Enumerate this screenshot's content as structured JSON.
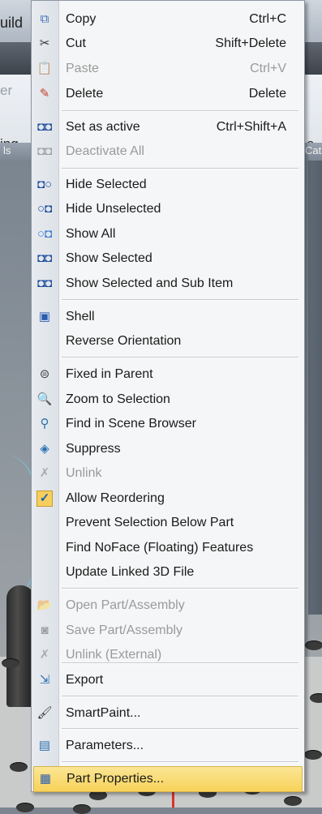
{
  "background": {
    "title_fragment": "uild",
    "ribbon_texts": [
      "er",
      "ing",
      "e"
    ],
    "ribbon_labels": [
      "ls",
      "Cata"
    ]
  },
  "menu": {
    "items": [
      {
        "label": "Copy",
        "shortcut": "Ctrl+C",
        "icon": "copy-icon",
        "glyph": "⧉",
        "color": "#3b6fb6",
        "disabled": false
      },
      {
        "label": "Cut",
        "shortcut": "Shift+Delete",
        "icon": "scissors-icon",
        "glyph": "✂",
        "color": "#333333",
        "disabled": false
      },
      {
        "label": "Paste",
        "shortcut": "Ctrl+V",
        "icon": "paste-icon",
        "glyph": "📋",
        "color": "#8a8a8a",
        "disabled": true
      },
      {
        "label": "Delete",
        "shortcut": "Delete",
        "icon": "eraser-icon",
        "glyph": "✎",
        "color": "#c2402a",
        "disabled": false
      },
      {
        "label": "Set as active",
        "shortcut": "Ctrl+Shift+A",
        "icon": "set-active-icon",
        "glyph": "◘◘",
        "color": "#1f4e9c",
        "disabled": false
      },
      {
        "label": "Deactivate All",
        "shortcut": "",
        "icon": "deactivate-all-icon",
        "glyph": "◘◘",
        "color": "#6a6a6a",
        "disabled": true
      },
      {
        "label": "Hide Selected",
        "shortcut": "",
        "icon": "hide-selected-icon",
        "glyph": "◘○",
        "color": "#1f4e9c",
        "disabled": false
      },
      {
        "label": "Hide Unselected",
        "shortcut": "",
        "icon": "hide-unselected-icon",
        "glyph": "○◘",
        "color": "#1f4e9c",
        "disabled": false
      },
      {
        "label": "Show All",
        "shortcut": "",
        "icon": "show-all-icon",
        "glyph": "○◘",
        "color": "#3f7fd0",
        "disabled": false
      },
      {
        "label": "Show Selected",
        "shortcut": "",
        "icon": "show-selected-icon",
        "glyph": "◘◘",
        "color": "#1f4e9c",
        "disabled": false
      },
      {
        "label": "Show Selected and Sub Item",
        "shortcut": "",
        "icon": "show-selected-sub-icon",
        "glyph": "◘◘",
        "color": "#1f4e9c",
        "disabled": false
      },
      {
        "label": "Shell",
        "shortcut": "",
        "icon": "shell-icon",
        "glyph": "▣",
        "color": "#2a5db0",
        "disabled": false
      },
      {
        "label": "Reverse Orientation",
        "shortcut": "",
        "icon": "",
        "glyph": "",
        "color": "#333333",
        "disabled": false
      },
      {
        "label": "Fixed in Parent",
        "shortcut": "",
        "icon": "fixed-in-parent-icon",
        "glyph": "⊜",
        "color": "#444444",
        "disabled": false
      },
      {
        "label": "Zoom to Selection",
        "shortcut": "",
        "icon": "zoom-icon",
        "glyph": "🔍",
        "color": "#444444",
        "disabled": false
      },
      {
        "label": "Find in Scene Browser",
        "shortcut": "",
        "icon": "find-scene-icon",
        "glyph": "⚲",
        "color": "#2a6fb0",
        "disabled": false
      },
      {
        "label": "Suppress",
        "shortcut": "",
        "icon": "suppress-icon",
        "glyph": "◈",
        "color": "#2a6fb0",
        "disabled": false
      },
      {
        "label": "Unlink",
        "shortcut": "",
        "icon": "unlink-icon",
        "glyph": "✗",
        "color": "#7a7a7a",
        "disabled": true
      },
      {
        "label": "Allow Reordering",
        "shortcut": "",
        "icon": "checkmark-icon",
        "glyph": "✓",
        "color": "#1f5fb5",
        "disabled": false,
        "checked": true
      },
      {
        "label": "Prevent Selection Below Part",
        "shortcut": "",
        "icon": "",
        "glyph": "",
        "color": "#333333",
        "disabled": false
      },
      {
        "label": "Find NoFace (Floating) Features",
        "shortcut": "",
        "icon": "",
        "glyph": "",
        "color": "#333333",
        "disabled": false
      },
      {
        "label": "Update Linked 3D File",
        "shortcut": "",
        "icon": "",
        "glyph": "",
        "color": "#333333",
        "disabled": false
      },
      {
        "label": "Open Part/Assembly",
        "shortcut": "",
        "icon": "open-folder-icon",
        "glyph": "📂",
        "color": "#666666",
        "disabled": true
      },
      {
        "label": "Save Part/Assembly",
        "shortcut": "",
        "icon": "save-icon",
        "glyph": "◙",
        "color": "#666666",
        "disabled": true
      },
      {
        "label": "Unlink (External)",
        "shortcut": "",
        "icon": "unlink-external-icon",
        "glyph": "✗",
        "color": "#7a7a7a",
        "disabled": true
      },
      {
        "label": "Export",
        "shortcut": "",
        "icon": "export-icon",
        "glyph": "⇲",
        "color": "#2a6fb0",
        "disabled": false
      },
      {
        "label": "SmartPaint...",
        "shortcut": "",
        "icon": "paintbrush-icon",
        "glyph": "🖌",
        "color": "#333333",
        "disabled": false
      },
      {
        "label": "Parameters...",
        "shortcut": "",
        "icon": "parameters-icon",
        "glyph": "▤",
        "color": "#2a6fb0",
        "disabled": false
      },
      {
        "label": "Part Properties...",
        "shortcut": "",
        "icon": "properties-icon",
        "glyph": "▦",
        "color": "#2a5db0",
        "disabled": false,
        "highlighted": true
      }
    ]
  }
}
